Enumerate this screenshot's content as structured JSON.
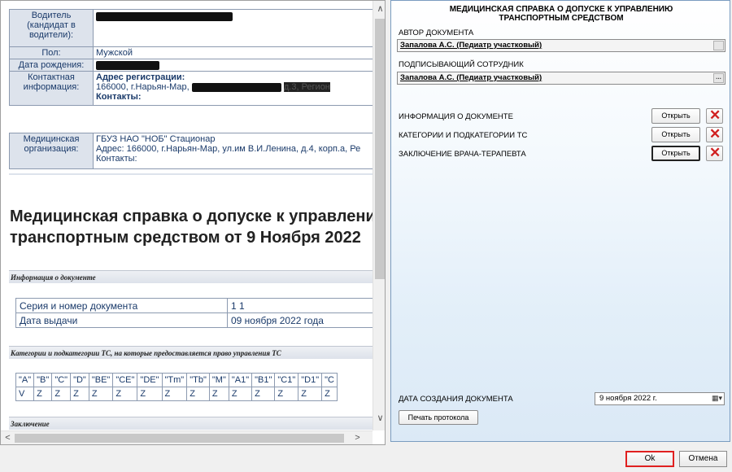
{
  "doc": {
    "driver_label": "Водитель (кандидат в водители):",
    "sex_label": "Пол:",
    "sex_value": "Мужской",
    "birth_label": "Дата рождения:",
    "contact_label": "Контактная информация:",
    "reg_heading": "Адрес регистрации:",
    "reg_address": "166000, г.Нарьян-Мар,",
    "reg_tail": "д.3, Регион",
    "contacts_heading": "Контакты:",
    "org_label": "Медицинская организация:",
    "org_name": "ГБУЗ НАО \"НОБ\" Стационар",
    "org_address": "Адрес: 166000, г.Нарьян-Мар, ул.им В.И.Ленина, д.4, корп.а, Ре",
    "org_contacts": "Контакты:",
    "title_line1": "Медицинская справка о допуске к управлени",
    "title_line2": "транспортным средством от 9 Ноября 2022",
    "section_info": "Информация о документе",
    "series_label": "Серия и номер документа",
    "series_value": "1 1",
    "issue_label": "Дата выдачи",
    "issue_value": "09 ноября 2022 года",
    "section_categories": "Категории и подкатегории ТС, на которые предоставляется право управления ТС",
    "categories": [
      "\"A\"",
      "\"B\"",
      "\"C\"",
      "\"D\"",
      "\"BE\"",
      "\"CE\"",
      "\"DE\"",
      "\"Tm\"",
      "\"Tb\"",
      "\"M\"",
      "\"A1\"",
      "\"B1\"",
      "\"C1\"",
      "\"D1\"",
      "\"C"
    ],
    "category_values": [
      "V",
      "Z",
      "Z",
      "Z",
      "Z",
      "Z",
      "Z",
      "Z",
      "Z",
      "Z",
      "Z",
      "Z",
      "Z",
      "Z",
      "Z"
    ],
    "section_conclusion": "Заключение"
  },
  "panel": {
    "title": "МЕДИЦИНСКАЯ СПРАВКА О ДОПУСКЕ К УПРАВЛЕНИЮ ТРАНСПОРТНЫМ СРЕДСТВОМ",
    "author_label": "АВТОР ДОКУМЕНТА",
    "author_value": "Запалова А.С. (Педиатр участковый)",
    "signer_label": "ПОДПИСЫВАЮЩИЙ СОТРУДНИК",
    "signer_value": "Запалова А.С. (Педиатр участковый)",
    "rows": [
      {
        "label": "ИНФОРМАЦИЯ О ДОКУМЕНТЕ",
        "button": "Открыть"
      },
      {
        "label": "КАТЕГОРИИ И ПОДКАТЕГОРИИ ТС",
        "button": "Открыть"
      },
      {
        "label": "ЗАКЛЮЧЕНИЕ ВРАЧА-ТЕРАПЕВТА",
        "button": "Открыть"
      }
    ],
    "date_label": "ДАТА СОЗДАНИЯ ДОКУМЕНТА",
    "date_value": "9  ноября  2022 г.",
    "print_button": "Печать протокола"
  },
  "footer": {
    "ok": "Ok",
    "cancel": "Отмена"
  }
}
